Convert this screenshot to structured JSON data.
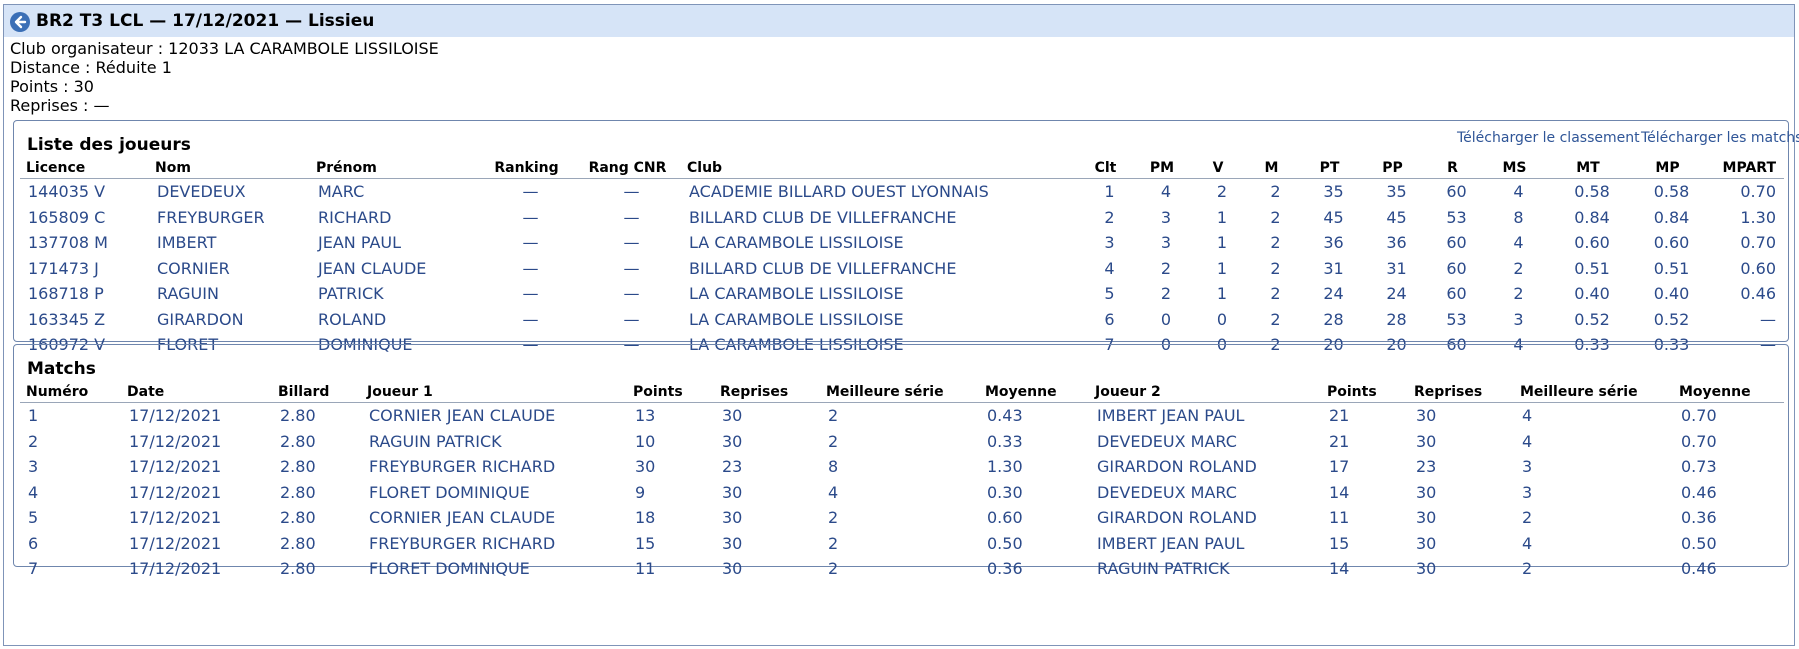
{
  "header": {
    "title": "BR2 T3 LCL — 17/12/2021 — Lissieu",
    "back_icon": "arrow-left-circle-icon"
  },
  "info": {
    "club": "Club organisateur : 12033 LA CARAMBOLE LISSILOISE",
    "distance": "Distance : Réduite 1",
    "points": "Points : 30",
    "reprises": "Reprises : —"
  },
  "players": {
    "title": "Liste des joueurs",
    "download_ranking": "Télécharger le classement",
    "download_matches": "Télécharger les matchs",
    "columns": [
      "Licence",
      "Nom",
      "Prénom",
      "Ranking",
      "Rang CNR",
      "Club",
      "Clt",
      "PM",
      "V",
      "M",
      "PT",
      "PP",
      "R",
      "MS",
      "MT",
      "MP",
      "MPART"
    ],
    "rows": [
      [
        "144035 V",
        "DEVEDEUX",
        "MARC",
        "—",
        "—",
        "ACADEMIE BILLARD OUEST LYONNAIS",
        "1",
        "4",
        "2",
        "2",
        "35",
        "35",
        "60",
        "4",
        "0.58",
        "0.58",
        "0.70"
      ],
      [
        "165809 C",
        "FREYBURGER",
        "RICHARD",
        "—",
        "—",
        "BILLARD CLUB DE VILLEFRANCHE",
        "2",
        "3",
        "1",
        "2",
        "45",
        "45",
        "53",
        "8",
        "0.84",
        "0.84",
        "1.30"
      ],
      [
        "137708 M",
        "IMBERT",
        "JEAN PAUL",
        "—",
        "—",
        "LA CARAMBOLE LISSILOISE",
        "3",
        "3",
        "1",
        "2",
        "36",
        "36",
        "60",
        "4",
        "0.60",
        "0.60",
        "0.70"
      ],
      [
        "171473 J",
        "CORNIER",
        "JEAN CLAUDE",
        "—",
        "—",
        "BILLARD CLUB DE VILLEFRANCHE",
        "4",
        "2",
        "1",
        "2",
        "31",
        "31",
        "60",
        "2",
        "0.51",
        "0.51",
        "0.60"
      ],
      [
        "168718 P",
        "RAGUIN",
        "PATRICK",
        "—",
        "—",
        "LA CARAMBOLE LISSILOISE",
        "5",
        "2",
        "1",
        "2",
        "24",
        "24",
        "60",
        "2",
        "0.40",
        "0.40",
        "0.46"
      ],
      [
        "163345 Z",
        "GIRARDON",
        "ROLAND",
        "—",
        "—",
        "LA CARAMBOLE LISSILOISE",
        "6",
        "0",
        "0",
        "2",
        "28",
        "28",
        "53",
        "3",
        "0.52",
        "0.52",
        "—"
      ],
      [
        "160972 V",
        "FLORET",
        "DOMINIQUE",
        "—",
        "—",
        "LA CARAMBOLE LISSILOISE",
        "7",
        "0",
        "0",
        "2",
        "20",
        "20",
        "60",
        "4",
        "0.33",
        "0.33",
        "—"
      ]
    ]
  },
  "matches": {
    "title": "Matchs",
    "columns": [
      "Numéro",
      "Date",
      "Billard",
      "Joueur 1",
      "Points",
      "Reprises",
      "Meilleure série",
      "Moyenne",
      "Joueur 2",
      "Points",
      "Reprises",
      "Meilleure série",
      "Moyenne"
    ],
    "rows": [
      [
        "1",
        "17/12/2021",
        "2.80",
        "CORNIER JEAN CLAUDE",
        "13",
        "30",
        "2",
        "0.43",
        "IMBERT JEAN PAUL",
        "21",
        "30",
        "4",
        "0.70"
      ],
      [
        "2",
        "17/12/2021",
        "2.80",
        "RAGUIN PATRICK",
        "10",
        "30",
        "2",
        "0.33",
        "DEVEDEUX MARC",
        "21",
        "30",
        "4",
        "0.70"
      ],
      [
        "3",
        "17/12/2021",
        "2.80",
        "FREYBURGER RICHARD",
        "30",
        "23",
        "8",
        "1.30",
        "GIRARDON ROLAND",
        "17",
        "23",
        "3",
        "0.73"
      ],
      [
        "4",
        "17/12/2021",
        "2.80",
        "FLORET DOMINIQUE",
        "9",
        "30",
        "4",
        "0.30",
        "DEVEDEUX MARC",
        "14",
        "30",
        "3",
        "0.46"
      ],
      [
        "5",
        "17/12/2021",
        "2.80",
        "CORNIER JEAN CLAUDE",
        "18",
        "30",
        "2",
        "0.60",
        "GIRARDON ROLAND",
        "11",
        "30",
        "2",
        "0.36"
      ],
      [
        "6",
        "17/12/2021",
        "2.80",
        "FREYBURGER RICHARD",
        "15",
        "30",
        "2",
        "0.50",
        "IMBERT JEAN PAUL",
        "15",
        "30",
        "4",
        "0.50"
      ],
      [
        "7",
        "17/12/2021",
        "2.80",
        "FLORET DOMINIQUE",
        "11",
        "30",
        "2",
        "0.36",
        "RAGUIN PATRICK",
        "14",
        "30",
        "2",
        "0.46"
      ]
    ]
  }
}
